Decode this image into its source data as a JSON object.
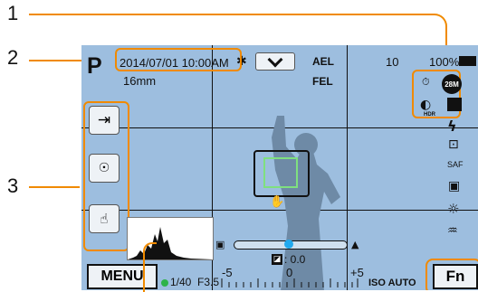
{
  "callouts": [
    "1",
    "2",
    "3"
  ],
  "top_bar": {
    "mode": "P",
    "focal": "16mm",
    "datetime": "2014/07/01 10:00AM",
    "ael": "AEL",
    "fel": "FEL",
    "shots": "10",
    "battery": "100%"
  },
  "right_icons": {
    "size": "28M",
    "saf": "SAF",
    "hdr": "HDR"
  },
  "exposure": {
    "comp": ": 0.0",
    "minus": "-5",
    "zero": "0",
    "plus": "+5"
  },
  "bottom": {
    "shutter": "1/40",
    "aperture": "F3.5",
    "iso": "ISO AUTO",
    "menu": "MENU",
    "fn": "Fn"
  },
  "side_icons": [
    "save-icon",
    "flash-off-icon",
    "touch-shutter-icon"
  ],
  "colors": {
    "accent": "#f08a00",
    "screen": "#9dbedf",
    "focus": "#7fe07f",
    "slider": "#21a9ee"
  }
}
